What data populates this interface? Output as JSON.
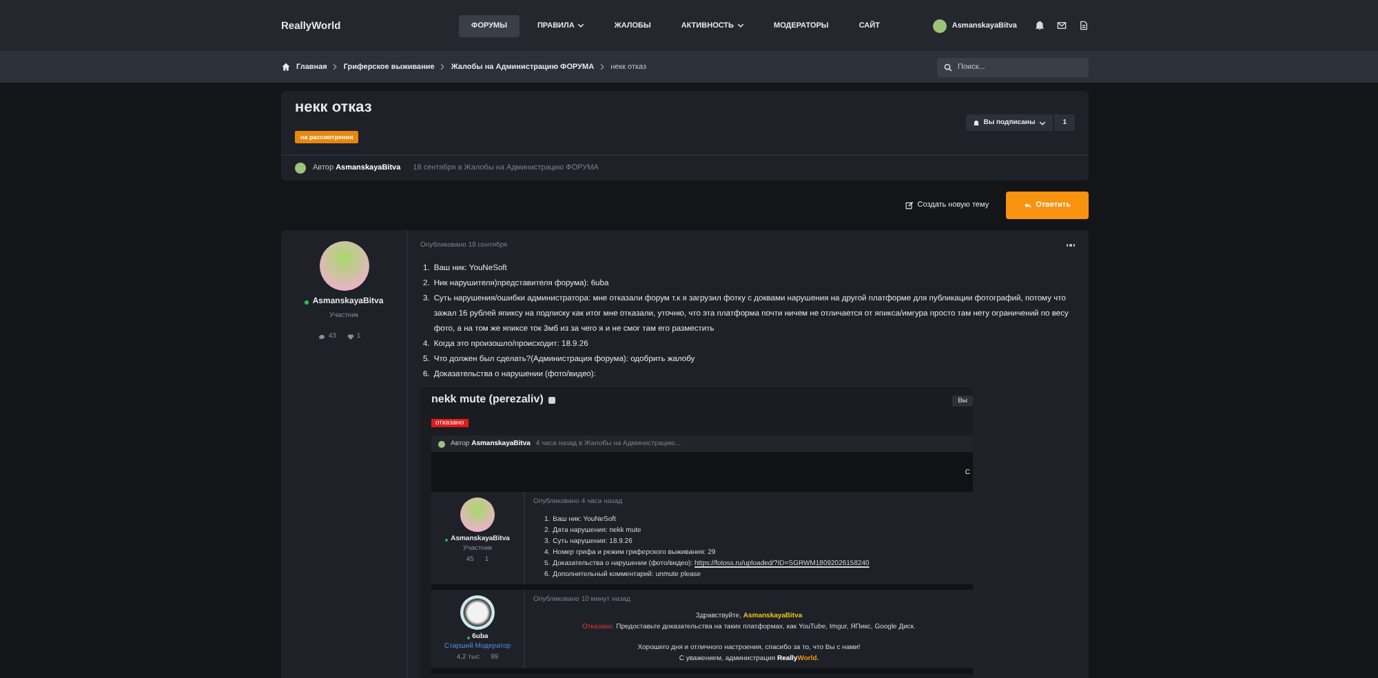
{
  "header": {
    "logo": "ReallyWorld",
    "nav": [
      {
        "label": "ФОРУМЫ",
        "selected": true,
        "dropdown": false
      },
      {
        "label": "ПРАВИЛА",
        "selected": false,
        "dropdown": true
      },
      {
        "label": "ЖАЛОБЫ",
        "selected": false,
        "dropdown": false
      },
      {
        "label": "АКТИВНОСТЬ",
        "selected": false,
        "dropdown": true
      },
      {
        "label": "МОДЕРАТОРЫ",
        "selected": false,
        "dropdown": false
      },
      {
        "label": "САЙТ",
        "selected": false,
        "dropdown": false
      }
    ],
    "user": "AsmanskayaBitva"
  },
  "breadcrumbs": [
    "Главная",
    "Гриферское выживание",
    "Жалобы на Администрацию ФОРУМА",
    "некк отказ"
  ],
  "search": {
    "placeholder": "Поиск..."
  },
  "thread": {
    "title": "некк отказ",
    "prefix": "на рассмотрении",
    "watch": "Вы подписаны",
    "watch_count": "1",
    "author_label": "Автор",
    "author": "AsmanskayaBitva",
    "meta": "18 сентября в Жалобы на Администрацию ФОРУМА"
  },
  "actions": {
    "new_thread": "Создать новую тему",
    "reply": "Ответить"
  },
  "post": {
    "user": {
      "name": "AsmanskayaBitva",
      "online": true,
      "role": "Участник",
      "messages": "43",
      "likes": "1"
    },
    "date": "Опубликовано 18 сентября",
    "items": [
      {
        "number": "1.",
        "text": "Ваш ник: YouNeSoft"
      },
      {
        "number": "2.",
        "text": "Ник нарушителя)представителя форума): 6uba"
      },
      {
        "number": "3.",
        "text": "Суть нарушения/ошибки администратора: мне отказали форум т.к я загрузил фотку с доквами нарушения на другой платформе для публикации фотографий, потому что зажал 16 рублей япиксу на подписку как итог мне отказали, уточню, что эта платформа почти ничем не отличается от япикса/имгура просто там нету ограничений по весу фото, а на том же япиксе ток 3мб из за чего я и не смог там его разместить"
      },
      {
        "number": "4.",
        "text": "Когда это произошло/происходит: 18.9.26"
      },
      {
        "number": "5.",
        "text": "Что должен был сделать?(Администрация форума): одобрить жалобу"
      },
      {
        "number": "6.",
        "text": "Доказательства о нарушении (фото/видео):"
      }
    ]
  },
  "attachment": {
    "title": "nekk mute (perezaliv)",
    "prefix": "отказано",
    "watch": "Вы",
    "author_label": "Автор",
    "author": "AsmanskayaBitva",
    "meta": "4 часа назад в Жалобы на Администрацию...",
    "bar_action": "С",
    "posts": [
      {
        "kind": "list",
        "user": {
          "name": "AsmanskayaBitva",
          "online": true,
          "role": "Участник",
          "messages": "45",
          "likes": "1"
        },
        "date": "Опубликовано 4 часа назад",
        "items": [
          {
            "number": "1.",
            "label": "Ваш ник:",
            "value": "YouNeSoft",
            "kind": "text"
          },
          {
            "number": "2.",
            "label": "Дата нарушения:",
            "value": "nekk mute",
            "kind": "text"
          },
          {
            "number": "3.",
            "label": "Суть нарушения:",
            "value": "18.9.26",
            "kind": "text"
          },
          {
            "number": "4.",
            "label": "Номер грифа и режим гриферского выживания:",
            "value": "29",
            "kind": "text"
          },
          {
            "number": "5.",
            "label": "Доказательства о нарушении (фото/видео):",
            "value": "https://fotoss.ru/uploaded/?ID=SGRWM18092026158240",
            "kind": "link"
          },
          {
            "number": "6.",
            "label": "Дополнительный комментарий:",
            "value": "unmute please",
            "kind": "text"
          }
        ]
      },
      {
        "kind": "reply",
        "user": {
          "name": "6uba",
          "online": true,
          "role": "Старший Модератор",
          "messages": "4,2 тыс",
          "likes": "99"
        },
        "date": "Опубликовано 10 минут назад",
        "paragraphs": [
          [
            {
              "parts": [
                {
                  "text": "Здравствуйте,",
                  "kind": "plain"
                },
                {
                  "text": "AsmanskayaBitva",
                  "kind": "highlight"
                }
              ]
            },
            {
              "parts": [
                {
                  "text": "Отказано.",
                  "kind": "refused"
                },
                {
                  "text": "Предоставьте доказательства на таких платформах, как YouTube, Imgur, ЯПикс, Google Диск.",
                  "kind": "plain"
                }
              ]
            }
          ],
          [
            {
              "parts": [
                {
                  "text": "Хорошего дня и отличного настроения, спасибо за то, что Вы с нами!",
                  "kind": "plain"
                }
              ]
            },
            {
              "parts": [
                {
                  "text": "С уважением, администрация",
                  "kind": "plain"
                },
                {
                  "text": "Really",
                  "kind": "brand"
                },
                {
                  "text": "World.",
                  "kind": "brand-accent"
                }
              ]
            }
          ]
        ]
      }
    ]
  }
}
